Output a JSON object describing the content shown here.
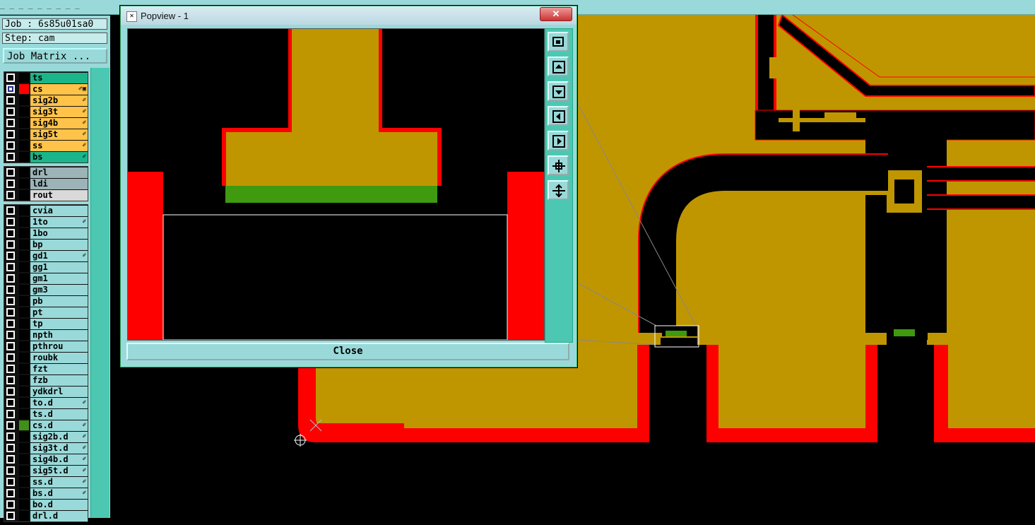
{
  "window": {
    "menu_fragment": "_ _ _ _ _ _ _ _ _"
  },
  "left_panel": {
    "job": "Job : 6s85u01sa0",
    "step": "Step: cam",
    "job_matrix_label": "Job Matrix ..."
  },
  "layer_groups": [
    {
      "layers": [
        {
          "name": "ts",
          "color": "#1ab68a",
          "checked": false,
          "swatch": "",
          "mark": ""
        },
        {
          "name": "cs",
          "color": "#ffc34a",
          "checked": true,
          "swatch": "#ff0000",
          "mark": "✐▣"
        },
        {
          "name": "sig2b",
          "color": "#ffc34a",
          "checked": false,
          "swatch": "",
          "mark": "✐"
        },
        {
          "name": "sig3t",
          "color": "#ffc34a",
          "checked": false,
          "swatch": "",
          "mark": "✐"
        },
        {
          "name": "sig4b",
          "color": "#ffc34a",
          "checked": false,
          "swatch": "",
          "mark": "✐"
        },
        {
          "name": "sig5t",
          "color": "#ffc34a",
          "checked": false,
          "swatch": "",
          "mark": "✐"
        },
        {
          "name": "ss",
          "color": "#ffc34a",
          "checked": false,
          "swatch": "",
          "mark": "✐"
        },
        {
          "name": "bs",
          "color": "#1ab68a",
          "checked": false,
          "swatch": "",
          "mark": "✐"
        }
      ]
    },
    {
      "layers": [
        {
          "name": "drl",
          "color": "#9cb4b8",
          "checked": false,
          "swatch": "",
          "mark": ""
        },
        {
          "name": "ldi",
          "color": "#9cb4b8",
          "checked": false,
          "swatch": "",
          "mark": ""
        },
        {
          "name": "rout",
          "color": "#d9d9d9",
          "checked": false,
          "swatch": "",
          "mark": ""
        }
      ]
    },
    {
      "layers": [
        {
          "name": "cvia",
          "color": "#9ad9d9",
          "checked": false,
          "swatch": "",
          "mark": ""
        },
        {
          "name": "1to",
          "color": "#9ad9d9",
          "checked": false,
          "swatch": "",
          "mark": "✐"
        },
        {
          "name": "1bo",
          "color": "#9ad9d9",
          "checked": false,
          "swatch": "",
          "mark": ""
        },
        {
          "name": "bp",
          "color": "#9ad9d9",
          "checked": false,
          "swatch": "",
          "mark": ""
        },
        {
          "name": "gd1",
          "color": "#9ad9d9",
          "checked": false,
          "swatch": "",
          "mark": "✐"
        },
        {
          "name": "gg1",
          "color": "#9ad9d9",
          "checked": false,
          "swatch": "",
          "mark": ""
        },
        {
          "name": "gm1",
          "color": "#9ad9d9",
          "checked": false,
          "swatch": "",
          "mark": ""
        },
        {
          "name": "gm3",
          "color": "#9ad9d9",
          "checked": false,
          "swatch": "",
          "mark": ""
        },
        {
          "name": "pb",
          "color": "#9ad9d9",
          "checked": false,
          "swatch": "",
          "mark": ""
        },
        {
          "name": "pt",
          "color": "#9ad9d9",
          "checked": false,
          "swatch": "",
          "mark": ""
        },
        {
          "name": "tp",
          "color": "#9ad9d9",
          "checked": false,
          "swatch": "",
          "mark": ""
        },
        {
          "name": "npth",
          "color": "#9ad9d9",
          "checked": false,
          "swatch": "",
          "mark": ""
        },
        {
          "name": "pthrou",
          "color": "#9ad9d9",
          "checked": false,
          "swatch": "",
          "mark": ""
        },
        {
          "name": "roubk",
          "color": "#9ad9d9",
          "checked": false,
          "swatch": "",
          "mark": ""
        },
        {
          "name": "fzt",
          "color": "#9ad9d9",
          "checked": false,
          "swatch": "",
          "mark": ""
        },
        {
          "name": "fzb",
          "color": "#9ad9d9",
          "checked": false,
          "swatch": "",
          "mark": ""
        },
        {
          "name": "ydkdrl",
          "color": "#9ad9d9",
          "checked": false,
          "swatch": "",
          "mark": ""
        },
        {
          "name": "to.d",
          "color": "#9ad9d9",
          "checked": false,
          "swatch": "",
          "mark": "✐"
        },
        {
          "name": "ts.d",
          "color": "#9ad9d9",
          "checked": false,
          "swatch": "",
          "mark": ""
        },
        {
          "name": "cs.d",
          "color": "#9ad9d9",
          "checked": false,
          "swatch": "#3f8f18",
          "mark": "✐"
        },
        {
          "name": "sig2b.d",
          "color": "#9ad9d9",
          "checked": false,
          "swatch": "",
          "mark": "✐"
        },
        {
          "name": "sig3t.d",
          "color": "#9ad9d9",
          "checked": false,
          "swatch": "",
          "mark": "✐"
        },
        {
          "name": "sig4b.d",
          "color": "#9ad9d9",
          "checked": false,
          "swatch": "",
          "mark": "✐"
        },
        {
          "name": "sig5t.d",
          "color": "#9ad9d9",
          "checked": false,
          "swatch": "",
          "mark": "✐"
        },
        {
          "name": "ss.d",
          "color": "#9ad9d9",
          "checked": false,
          "swatch": "",
          "mark": "✐"
        },
        {
          "name": "bs.d",
          "color": "#9ad9d9",
          "checked": false,
          "swatch": "",
          "mark": "✐"
        },
        {
          "name": "bo.d",
          "color": "#9ad9d9",
          "checked": false,
          "swatch": "",
          "mark": ""
        },
        {
          "name": "drl.d",
          "color": "#9ad9d9",
          "checked": false,
          "swatch": "",
          "mark": ""
        }
      ]
    }
  ],
  "popview": {
    "title": "Popview - 1",
    "close_x": "✕",
    "close_button": "Close",
    "tools": [
      {
        "icon": "zoom-window-icon"
      },
      {
        "icon": "pan-up-icon"
      },
      {
        "icon": "pan-down-icon"
      },
      {
        "icon": "pan-left-icon"
      },
      {
        "icon": "pan-right-icon"
      },
      {
        "icon": "zoom-in-icon"
      },
      {
        "icon": "zoom-out-icon"
      }
    ]
  },
  "colors": {
    "copper": "#c09600",
    "trace_red": "#ff0000",
    "pad_green": "#3f9a10",
    "ui_teal": "#9ad9d9",
    "scroll_green": "#4cc8b2"
  }
}
